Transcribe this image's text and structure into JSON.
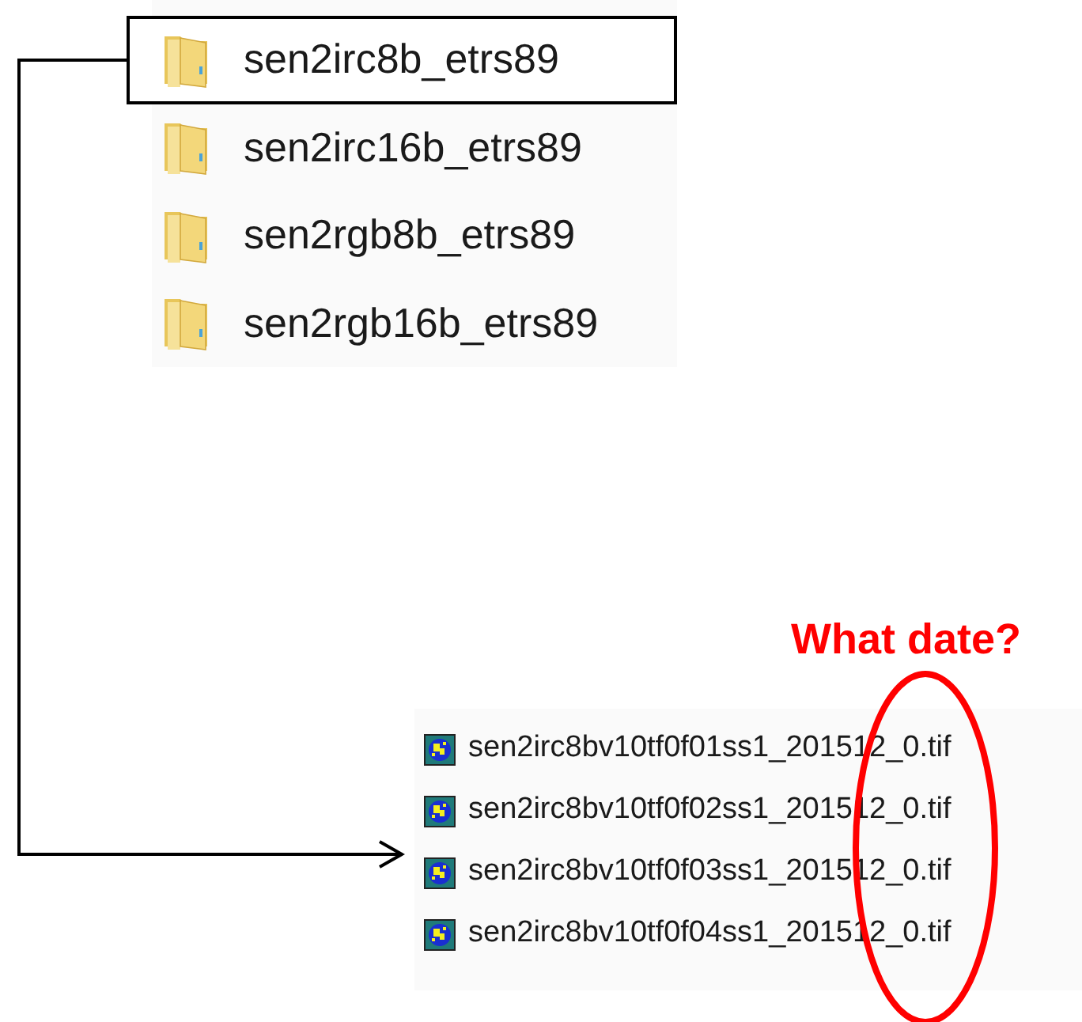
{
  "folders": [
    {
      "name": "sen2irc8b_etrs89",
      "selected": true
    },
    {
      "name": "sen2irc16b_etrs89",
      "selected": false
    },
    {
      "name": "sen2rgb8b_etrs89",
      "selected": false
    },
    {
      "name": "sen2rgb16b_etrs89",
      "selected": false
    }
  ],
  "annotation": {
    "question": "What date?"
  },
  "files": [
    {
      "name": "sen2irc8bv10tf0f01ss1_201512_0.tif"
    },
    {
      "name": "sen2irc8bv10tf0f02ss1_201512_0.tif"
    },
    {
      "name": "sen2irc8bv10tf0f03ss1_201512_0.tif"
    },
    {
      "name": "sen2irc8bv10tf0f04ss1_201512_0.tif"
    }
  ]
}
